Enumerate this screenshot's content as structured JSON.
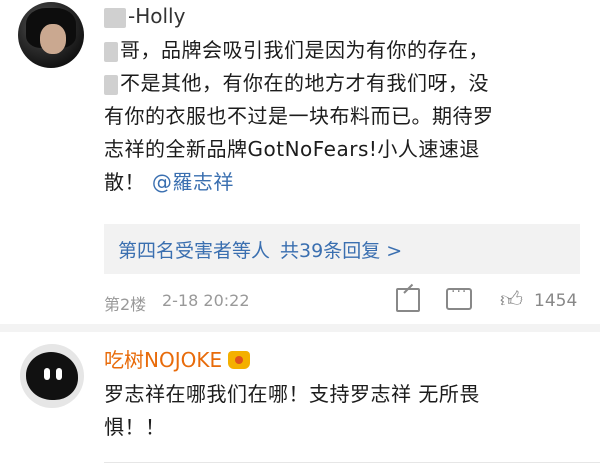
{
  "comments": [
    {
      "username": "-Holly",
      "lines": [
        "哥，品牌会吸引我们是因为有你的存在，",
        "不是其他，有你在的地方才有我们呀，没",
        "有你的衣服也不过是一块布料而已。期待罗",
        "志祥的全新品牌GotNoFears!小人速速退",
        "散！"
      ],
      "mention": "@羅志祥",
      "replies": {
        "names": "第四名受害者",
        "plain": "等人",
        "count": "共39条回复 >"
      },
      "floor": "第2楼",
      "time": "2-18 20:22",
      "likes": "1454",
      "icons": [
        "share-icon",
        "comment-icon",
        "like-icon"
      ]
    },
    {
      "username": "吃树NOJOKE",
      "lines": [
        "罗志祥在哪我们在哪！支持罗志祥  无所畏",
        "惧！！"
      ]
    }
  ],
  "colors": {
    "link": "#3a6fb0",
    "username_highlight": "#e86b0a",
    "meta": "#999999"
  }
}
